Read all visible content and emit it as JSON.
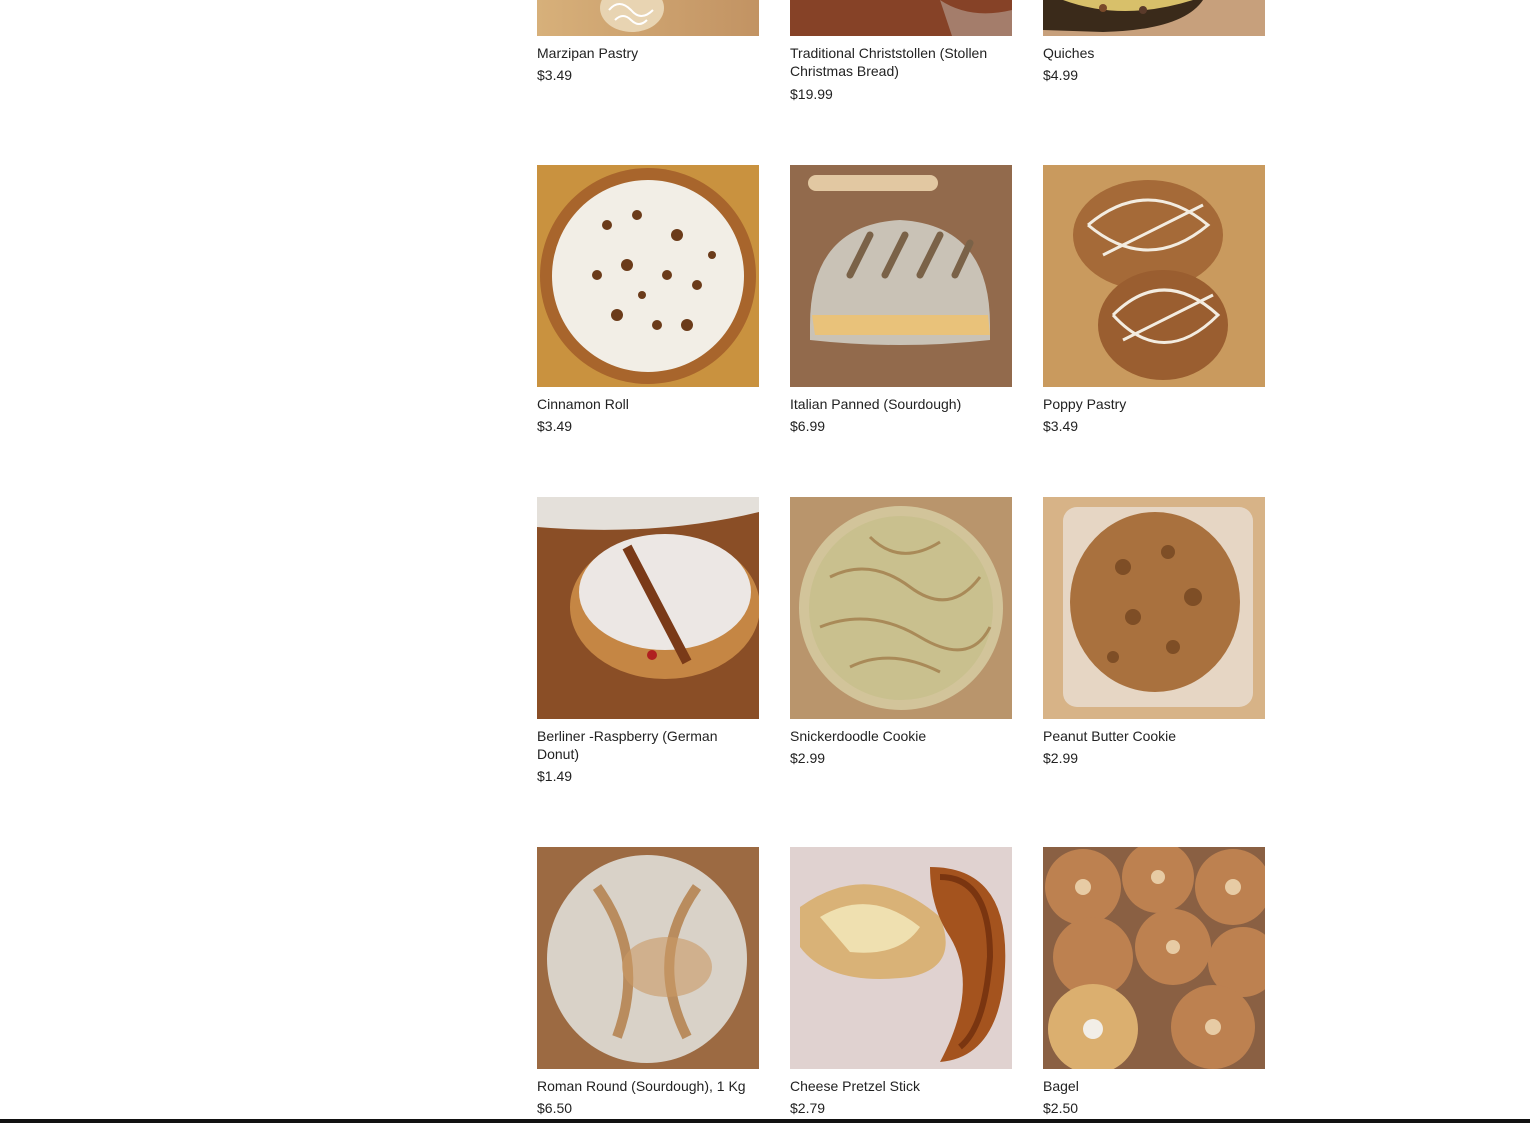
{
  "products": [
    {
      "name": "Marzipan Pastry",
      "price": "$3.49",
      "image": "marzipan-pastry-photo"
    },
    {
      "name": "Traditional Christstollen (Stollen Christmas Bread)",
      "price": "$19.99",
      "image": "christstollen-photo"
    },
    {
      "name": "Quiches",
      "price": "$4.99",
      "image": "quiche-photo"
    },
    {
      "name": "Cinnamon Roll",
      "price": "$3.49",
      "image": "cinnamon-roll-photo"
    },
    {
      "name": "Italian Panned (Sourdough)",
      "price": "$6.99",
      "image": "italian-panned-bread-photo"
    },
    {
      "name": "Poppy Pastry",
      "price": "$3.49",
      "image": "poppy-pastry-photo"
    },
    {
      "name": "Berliner -Raspberry (German Donut)",
      "price": "$1.49",
      "image": "berliner-donut-photo"
    },
    {
      "name": "Snickerdoodle Cookie",
      "price": "$2.99",
      "image": "snickerdoodle-cookie-photo"
    },
    {
      "name": "Peanut Butter Cookie",
      "price": "$2.99",
      "image": "peanut-butter-cookie-photo"
    },
    {
      "name": "Roman Round (Sourdough), 1 Kg",
      "price": "$6.50",
      "image": "roman-round-bread-photo"
    },
    {
      "name": "Cheese Pretzel Stick",
      "price": "$2.79",
      "image": "cheese-pretzel-photo"
    },
    {
      "name": "Bagel",
      "price": "$2.50",
      "image": "bagel-photo"
    }
  ]
}
